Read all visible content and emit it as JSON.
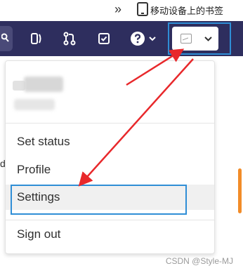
{
  "bookmark_bar": {
    "overflow_icon": "double-chevron-right-icon",
    "mobile_bookmarks_icon": "mobile-device-icon",
    "mobile_bookmarks_label": "移动设备上的书签"
  },
  "navbar": {
    "background": "#2e2e5e",
    "icons": [
      "search-icon",
      "merge-requests-icon",
      "pull-request-icon",
      "todo-check-icon",
      "help-icon",
      "chevron-down-icon"
    ],
    "avatar": {
      "icon": "broken-image-icon",
      "chevron": "chevron-down-icon"
    }
  },
  "left_partial_text": "d",
  "menu": {
    "items": [
      {
        "label": "Set status"
      },
      {
        "label": "Profile"
      },
      {
        "label": "Settings"
      },
      {
        "label": "Sign out"
      }
    ]
  },
  "annotations": {
    "highlight_color": "#2f8ed6",
    "arrow_color": "#e8282b"
  },
  "watermark": "CSDN @Style-MJ"
}
